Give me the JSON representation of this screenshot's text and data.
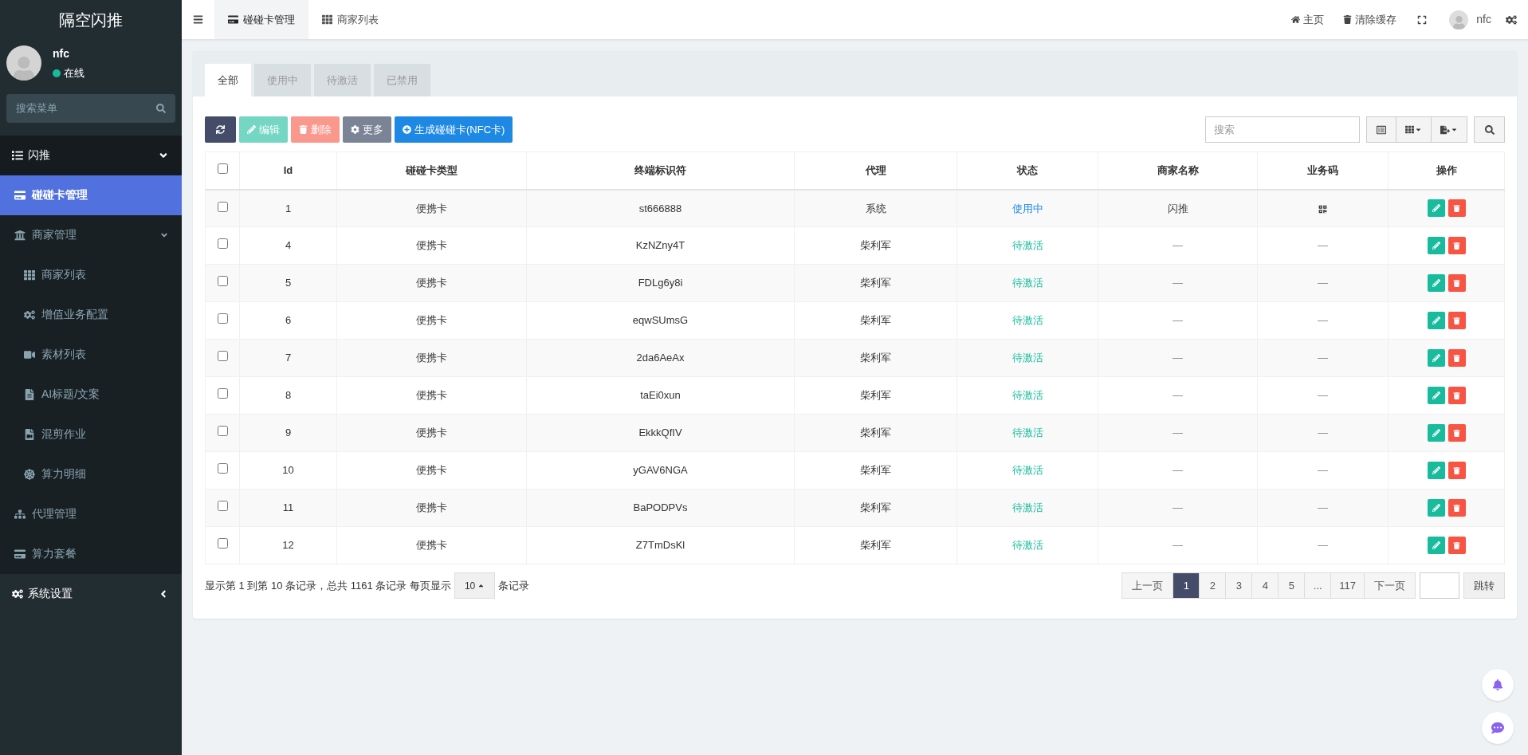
{
  "sidebar": {
    "logo": "隔空闪推",
    "user": {
      "name": "nfc",
      "status": "在线"
    },
    "search": {
      "placeholder": "搜索菜单"
    },
    "menu": [
      {
        "label": "闪推",
        "expanded": true,
        "selected": false,
        "children": [
          {
            "label": "碰碰卡管理",
            "selected": true
          },
          {
            "label": "商家管理",
            "expanded": true,
            "selected": false,
            "children": [
              {
                "label": "商家列表",
                "selected": false
              },
              {
                "label": "增值业务配置",
                "selected": false
              },
              {
                "label": "素材列表",
                "selected": false
              },
              {
                "label": "AI标题/文案",
                "selected": false
              },
              {
                "label": "混剪作业",
                "selected": false
              },
              {
                "label": "算力明细",
                "selected": false
              }
            ]
          },
          {
            "label": "代理管理",
            "selected": false
          },
          {
            "label": "算力套餐",
            "selected": false
          }
        ]
      },
      {
        "label": "系统设置",
        "expanded": false,
        "selected": false
      }
    ]
  },
  "topbar": {
    "tabs": [
      {
        "label": "碰碰卡管理",
        "selected": true
      },
      {
        "label": "商家列表",
        "selected": false
      }
    ],
    "links": [
      "主页",
      "清除缓存"
    ],
    "user": "nfc"
  },
  "panel": {
    "tabs": [
      {
        "label": "全部",
        "selected": true
      },
      {
        "label": "使用中",
        "selected": false
      },
      {
        "label": "待激活",
        "selected": false
      },
      {
        "label": "已禁用",
        "selected": false
      }
    ],
    "toolbar": [
      {
        "label": "编辑",
        "kind": "edit",
        "disabled": true
      },
      {
        "label": "删除",
        "kind": "delete",
        "disabled": true
      },
      {
        "label": "更多",
        "kind": "more",
        "disabled": false
      },
      {
        "label": "生成碰碰卡(NFC卡)",
        "kind": "add",
        "disabled": false
      }
    ],
    "search": {
      "placeholder": "搜索"
    },
    "table": {
      "select_all": {
        "checked": false
      },
      "columns": [
        "Id",
        "碰碰卡类型",
        "终端标识符",
        "代理",
        "状态",
        "商家名称",
        "业务码",
        "操作"
      ],
      "rows": [
        {
          "checked": false,
          "id": "1",
          "type": "便携卡",
          "terminal": "st666888",
          "agent": "系统",
          "status": {
            "text": "使用中",
            "kind": "in_use"
          },
          "merchant": "闪推",
          "code": {
            "kind": "qr"
          }
        },
        {
          "checked": false,
          "id": "4",
          "type": "便携卡",
          "terminal": "KzNZny4T",
          "agent": "柴利军",
          "status": {
            "text": "待激活",
            "kind": "pending"
          },
          "merchant": "—",
          "code": {
            "kind": "text",
            "text": "—"
          }
        },
        {
          "checked": false,
          "id": "5",
          "type": "便携卡",
          "terminal": "FDLg6y8i",
          "agent": "柴利军",
          "status": {
            "text": "待激活",
            "kind": "pending"
          },
          "merchant": "—",
          "code": {
            "kind": "text",
            "text": "—"
          }
        },
        {
          "checked": false,
          "id": "6",
          "type": "便携卡",
          "terminal": "eqwSUmsG",
          "agent": "柴利军",
          "status": {
            "text": "待激活",
            "kind": "pending"
          },
          "merchant": "—",
          "code": {
            "kind": "text",
            "text": "—"
          }
        },
        {
          "checked": false,
          "id": "7",
          "type": "便携卡",
          "terminal": "2da6AeAx",
          "agent": "柴利军",
          "status": {
            "text": "待激活",
            "kind": "pending"
          },
          "merchant": "—",
          "code": {
            "kind": "text",
            "text": "—"
          }
        },
        {
          "checked": false,
          "id": "8",
          "type": "便携卡",
          "terminal": "taEi0xun",
          "agent": "柴利军",
          "status": {
            "text": "待激活",
            "kind": "pending"
          },
          "merchant": "—",
          "code": {
            "kind": "text",
            "text": "—"
          }
        },
        {
          "checked": false,
          "id": "9",
          "type": "便携卡",
          "terminal": "EkkkQfIV",
          "agent": "柴利军",
          "status": {
            "text": "待激活",
            "kind": "pending"
          },
          "merchant": "—",
          "code": {
            "kind": "text",
            "text": "—"
          }
        },
        {
          "checked": false,
          "id": "10",
          "type": "便携卡",
          "terminal": "yGAV6NGA",
          "agent": "柴利军",
          "status": {
            "text": "待激活",
            "kind": "pending"
          },
          "merchant": "—",
          "code": {
            "kind": "text",
            "text": "—"
          }
        },
        {
          "checked": false,
          "id": "11",
          "type": "便携卡",
          "terminal": "BaPODPVs",
          "agent": "柴利军",
          "status": {
            "text": "待激活",
            "kind": "pending"
          },
          "merchant": "—",
          "code": {
            "kind": "text",
            "text": "—"
          }
        },
        {
          "checked": false,
          "id": "12",
          "type": "便携卡",
          "terminal": "Z7TmDsKl",
          "agent": "柴利军",
          "status": {
            "text": "待激活",
            "kind": "pending"
          },
          "merchant": "—",
          "code": {
            "kind": "text",
            "text": "—"
          }
        }
      ]
    },
    "footer": {
      "summary": "显示第 1 到第 10 条记录，总共 1161 条记录 每页显示",
      "page_size": "10",
      "suffix": "条记录"
    },
    "pagination": {
      "prev": "上一页",
      "pages": [
        {
          "label": "1",
          "selected": true
        },
        {
          "label": "2",
          "selected": false
        },
        {
          "label": "3",
          "selected": false
        },
        {
          "label": "4",
          "selected": false
        },
        {
          "label": "5",
          "selected": false
        },
        {
          "label": "...",
          "selected": false
        },
        {
          "label": "117",
          "selected": false
        }
      ],
      "next": "下一页",
      "jump": "跳转"
    }
  }
}
